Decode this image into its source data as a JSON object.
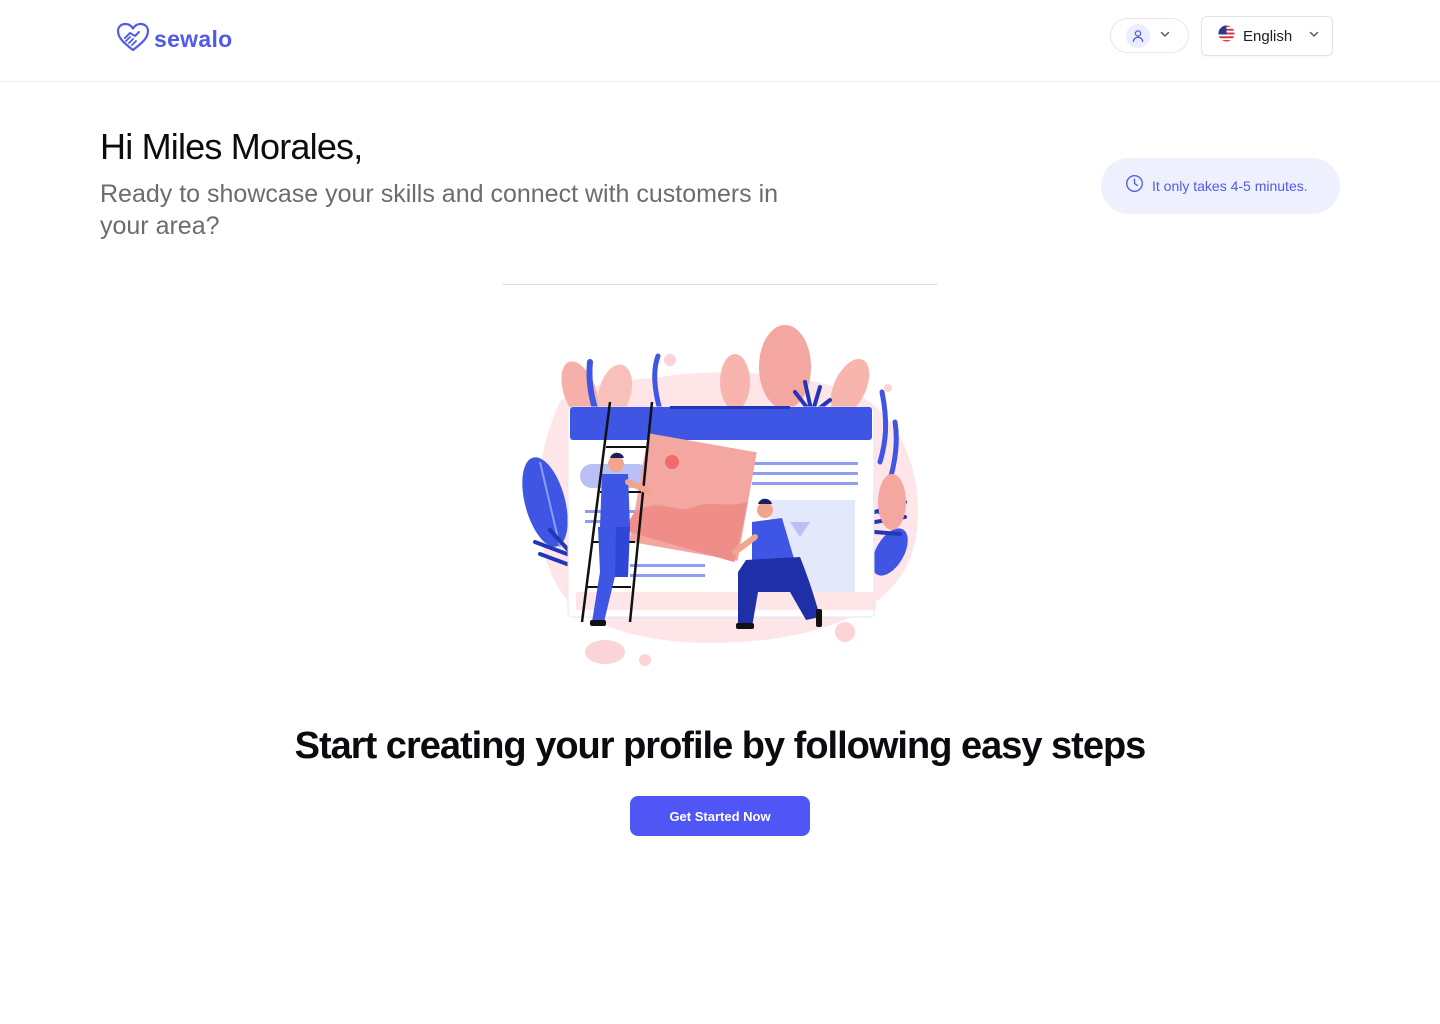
{
  "header": {
    "logo_text": "sewalo",
    "language_label": "English"
  },
  "greeting": {
    "title": "Hi Miles Morales,",
    "subtitle": "Ready to showcase your skills and connect with customers in your area?"
  },
  "time_notice": "It only takes 4-5 minutes.",
  "main": {
    "headline": "Start creating your profile by following easy steps",
    "cta_label": "Get Started Now"
  },
  "icons": {
    "logo": "handshake-heart-icon",
    "user": "user-icon",
    "user_chevron": "chevron-down-icon",
    "flag": "us-flag-icon",
    "lang_chevron": "chevron-down-icon",
    "clock": "clock-icon"
  },
  "colors": {
    "brand": "#4f5bea",
    "cta": "#4f56f5",
    "pill_bg": "#eef0fd",
    "subtext": "#6b6b73",
    "illustration_pink": "#f4a6a0",
    "illustration_blue": "#3f55e3"
  }
}
